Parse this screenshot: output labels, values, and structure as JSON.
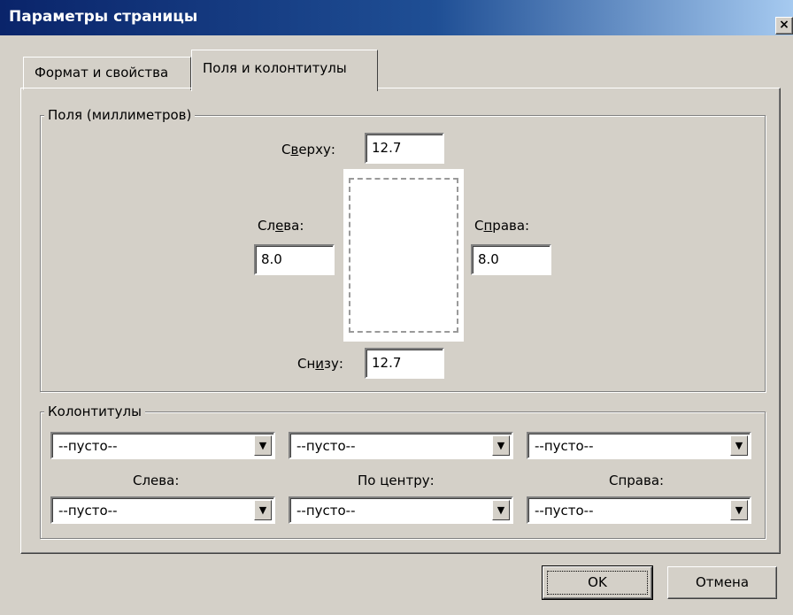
{
  "window": {
    "title": "Параметры страницы",
    "close": "×"
  },
  "tabs": [
    {
      "label": "Формат и свойства",
      "active": false
    },
    {
      "label": "Поля и колонтитулы",
      "active": true
    }
  ],
  "margins": {
    "group_title": "Поля (миллиметров)",
    "top": {
      "label_pre": "С",
      "label_u": "в",
      "label_post": "ерху:",
      "value": "12.7"
    },
    "left": {
      "label_pre": "Сл",
      "label_u": "е",
      "label_post": "ва:",
      "value": "8.0"
    },
    "right": {
      "label_pre": "С",
      "label_u": "п",
      "label_post": "рава:",
      "value": "8.0"
    },
    "bottom": {
      "label_pre": "Сн",
      "label_u": "и",
      "label_post": "зу:",
      "value": "12.7"
    }
  },
  "headers": {
    "group_title": "Колонтитулы",
    "header_combos": [
      "--пусто--",
      "--пусто--",
      "--пусто--"
    ],
    "labels": [
      "Слева:",
      "По центру:",
      "Справа:"
    ],
    "footer_combos": [
      "--пусто--",
      "--пусто--",
      "--пусто--"
    ]
  },
  "buttons": {
    "ok": "OK",
    "cancel": "Отмена"
  },
  "icons": {
    "dropdown": "▼"
  }
}
